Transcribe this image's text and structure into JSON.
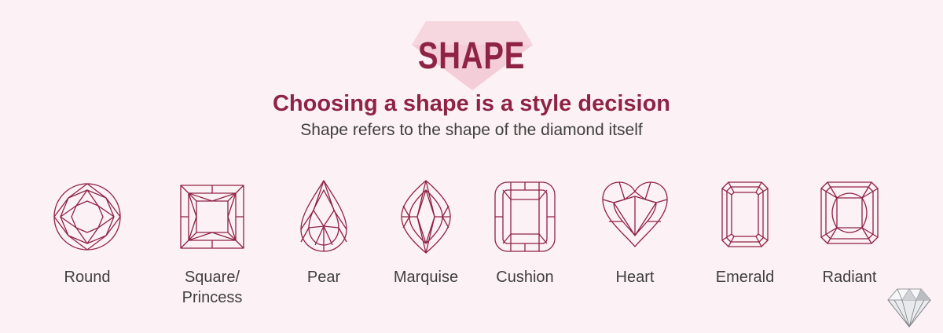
{
  "header": {
    "title": "SHAPE",
    "headline": "Choosing a shape is a style decision",
    "subline": "Shape refers to the shape of the diamond itself"
  },
  "colors": {
    "accent": "#8e2346",
    "background": "#fcf1f4",
    "badge": "#f3cdd8",
    "text": "#3f3f3f"
  },
  "shapes": [
    {
      "label": "Round",
      "icon": "round-diamond-icon"
    },
    {
      "label": "Square/\nPrincess",
      "icon": "princess-diamond-icon"
    },
    {
      "label": "Pear",
      "icon": "pear-diamond-icon"
    },
    {
      "label": "Marquise",
      "icon": "marquise-diamond-icon"
    },
    {
      "label": "Cushion",
      "icon": "cushion-diamond-icon"
    },
    {
      "label": "Heart",
      "icon": "heart-diamond-icon"
    },
    {
      "label": "Emerald",
      "icon": "emerald-diamond-icon"
    },
    {
      "label": "Radiant",
      "icon": "radiant-diamond-icon"
    }
  ]
}
